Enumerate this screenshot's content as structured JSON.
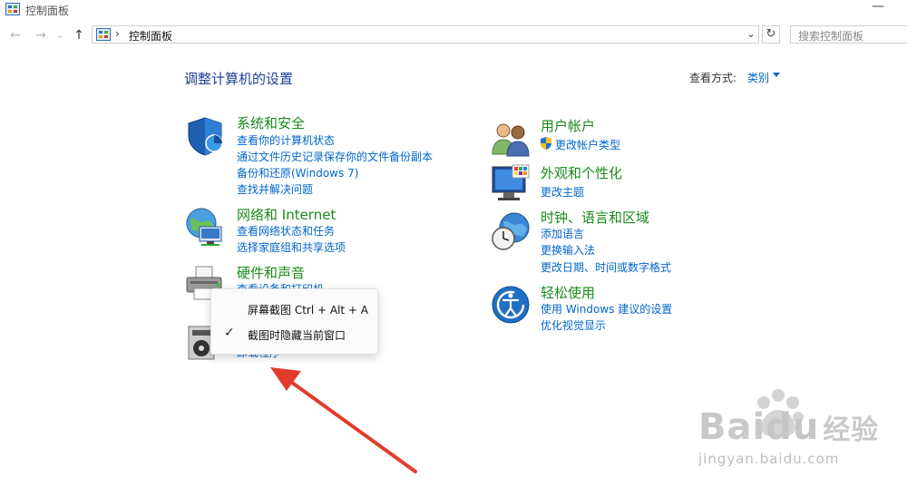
{
  "window": {
    "title": "控制面板",
    "minimize_glyph": "—"
  },
  "nav": {
    "back_glyph": "←",
    "forward_glyph": "→",
    "history_glyph": "⌄",
    "up_glyph": "↑",
    "address_sep": "›",
    "address_text": "控制面板",
    "address_drop_glyph": "⌄",
    "refresh_glyph": "↻",
    "search_placeholder": "搜索控制面板"
  },
  "header": {
    "title": "调整计算机的设置",
    "view_by_label": "查看方式:",
    "view_by_value": "类别"
  },
  "left_categories": [
    {
      "title": "系统和安全",
      "icon": "shield-icon",
      "links": [
        "查看你的计算机状态",
        "通过文件历史记录保存你的文件备份副本",
        "备份和还原(Windows 7)",
        "查找并解决问题"
      ]
    },
    {
      "title": "网络和 Internet",
      "icon": "network-globe-icon",
      "links": [
        "查看网络状态和任务",
        "选择家庭组和共享选项"
      ]
    },
    {
      "title": "硬件和声音",
      "icon": "printer-icon",
      "links": [
        "查看设备和打印机"
      ]
    },
    {
      "title": "",
      "icon": "programs-disc-icon",
      "links": [
        "卸载程序"
      ]
    }
  ],
  "right_categories": [
    {
      "title": "用户帐户",
      "icon": "users-icon",
      "links": [
        "更改帐户类型"
      ]
    },
    {
      "title": "外观和个性化",
      "icon": "monitor-icon",
      "links": [
        "更改主题"
      ]
    },
    {
      "title": "时钟、语言和区域",
      "icon": "clock-globe-icon",
      "links": [
        "添加语言",
        "更换输入法",
        "更改日期、时间或数字格式"
      ]
    },
    {
      "title": "轻松使用",
      "icon": "ease-of-access-icon",
      "links": [
        "使用 Windows 建议的设置",
        "优化视觉显示"
      ]
    }
  ],
  "context_menu": {
    "items": [
      "屏幕截图 Ctrl + Alt + A",
      "截图时隐藏当前窗口"
    ],
    "checked_glyph": "✓"
  },
  "watermark": {
    "brand": "Bai",
    "brand2": "du",
    "brand_cn": "经验",
    "url": "jingyan.baidu.com"
  },
  "colors": {
    "link": "#0066cc",
    "category": "#1a8a1a",
    "heading": "#1c3f94",
    "arrow": "#e23b2e"
  }
}
